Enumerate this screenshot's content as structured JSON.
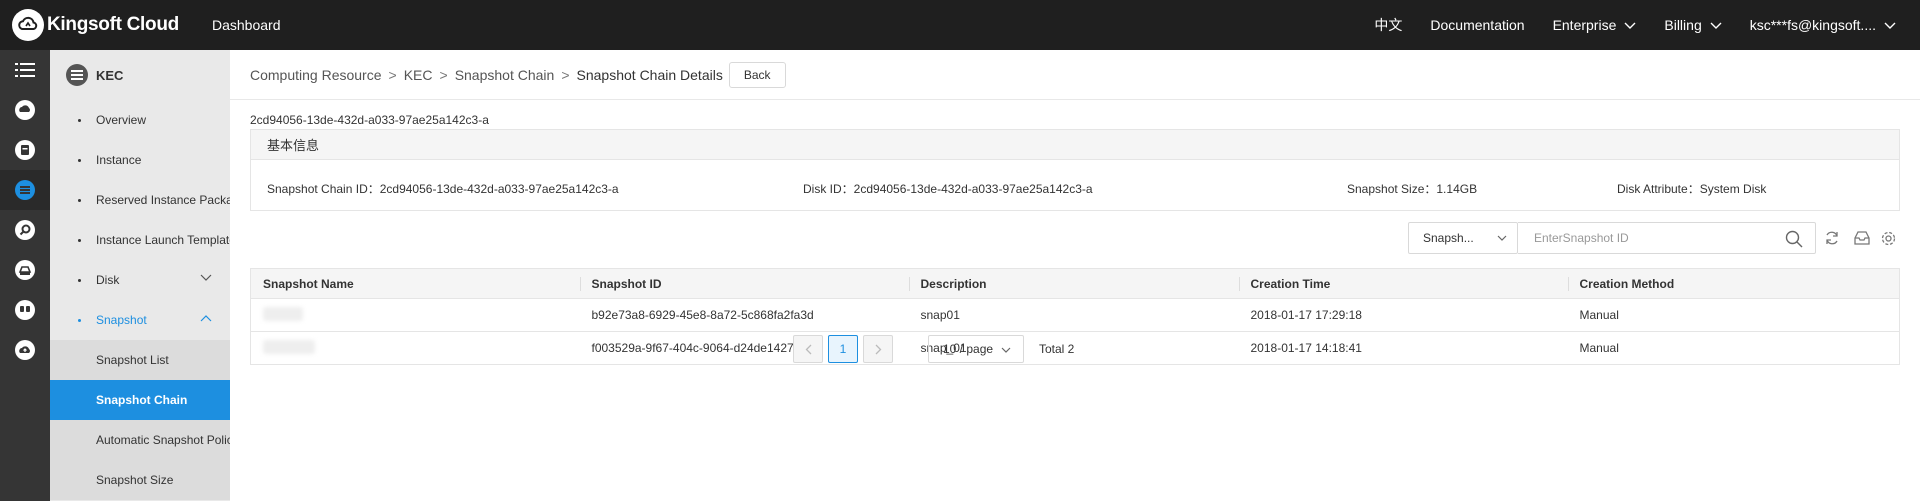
{
  "topbar": {
    "brand": "Kingsoft Cloud",
    "dashboard": "Dashboard",
    "language": "中文",
    "documentation": "Documentation",
    "enterprise": "Enterprise",
    "billing": "Billing",
    "account": "ksc***fs@kingsoft...."
  },
  "rail": [
    "menu-icon",
    "cloud-server-icon",
    "database-icon",
    "kec-icon",
    "search-icon",
    "storage-icon",
    "people-icon",
    "cloud-upload-icon"
  ],
  "submenu": {
    "title": "KEC",
    "overview": "Overview",
    "instance": "Instance",
    "reserved": "Reserved Instance Package",
    "launch_template": "Instance Launch Template",
    "disk": "Disk",
    "snapshot": "Snapshot",
    "snapshot_list": "Snapshot List",
    "snapshot_chain": "Snapshot Chain",
    "auto_policy": "Automatic Snapshot Policy",
    "snapshot_size": "Snapshot Size"
  },
  "breadcrumb": {
    "items": [
      "Computing Resource",
      "KEC",
      "Snapshot Chain"
    ],
    "current": "Snapshot Chain Details",
    "separator": ">",
    "back": "Back"
  },
  "chain_id_heading": "2cd94056-13de-432d-a033-97ae25a142c3-a",
  "basic_info": {
    "title": "基本信息",
    "chain_id": "Snapshot Chain ID：2cd94056-13de-432d-a033-97ae25a142c3-a",
    "disk_id": "Disk ID：2cd94056-13de-432d-a033-97ae25a142c3-a",
    "snapshot_size": "Snapshot Size：1.14GB",
    "disk_attribute": "Disk Attribute：System Disk"
  },
  "toolbar": {
    "select_value": "Snapsh...",
    "search_placeholder": "EnterSnapshot ID"
  },
  "table": {
    "headers": [
      "Snapshot Name",
      "Snapshot ID",
      "Description",
      "Creation Time",
      "Creation Method"
    ],
    "rows": [
      {
        "id": "b92e73a8-6929-45e8-8a72-5c868fa2fa3d",
        "description": "snap01",
        "time": "2018-01-17 17:29:18",
        "method": "Manual"
      },
      {
        "id": "f003529a-9f67-404c-9064-d24de1427bbb",
        "description": "snap_01",
        "time": "2018-01-17 14:18:41",
        "method": "Manual"
      }
    ]
  },
  "pagination": {
    "prev": "<",
    "current_page": "1",
    "next": ">",
    "page_size": "10 / page",
    "total": "Total 2"
  },
  "colors": {
    "accent": "#1d8fe0",
    "topbar": "#1f1f1f",
    "rail": "#353535",
    "submenu": "#e9e9e9"
  }
}
